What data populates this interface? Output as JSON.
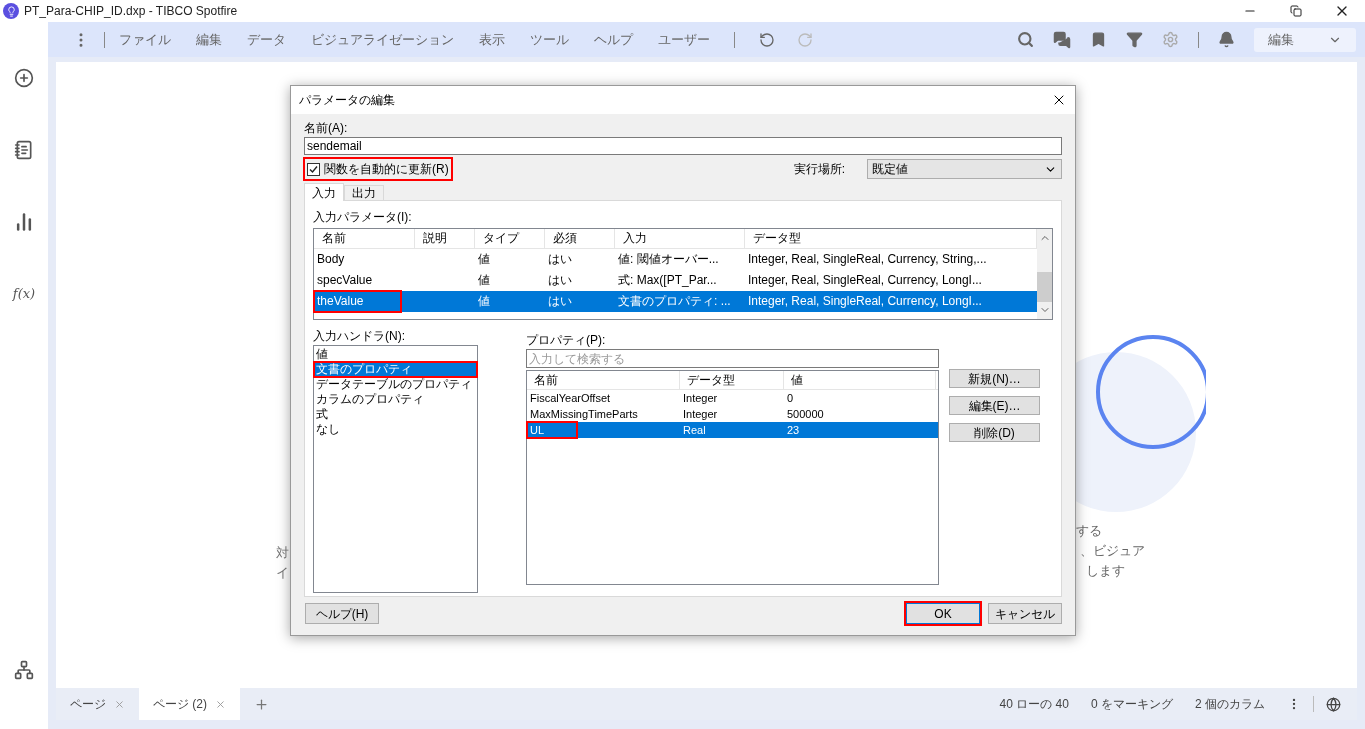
{
  "window": {
    "title": "PT_Para-CHIP_ID.dxp - TIBCO Spotfire"
  },
  "menu": [
    "ファイル",
    "編集",
    "データ",
    "ビジュアライゼーション",
    "表示",
    "ツール",
    "ヘルプ",
    "ユーザー"
  ],
  "mode_select": {
    "value": "編集"
  },
  "sidebar_formula": "f(x)",
  "canvas_fragments": {
    "left": [
      "対",
      "イ"
    ],
    "right": [
      "する",
      "、ビジュア",
      "します"
    ]
  },
  "dialog": {
    "title": "パラメータの編集",
    "name_label": "名前(A):",
    "name_value": "sendemail",
    "auto_update": {
      "label": "関数を自動的に更新(R)",
      "checked": true,
      "annotated": true
    },
    "location": {
      "label": "実行場所:",
      "value": "既定値"
    },
    "tabs": [
      {
        "label": "入力",
        "selected": true
      },
      {
        "label": "出力",
        "selected": false
      }
    ],
    "params_label": "入力パラメータ(I):",
    "params_table": {
      "columns": [
        "名前",
        "説明",
        "タイプ",
        "必須",
        "入力",
        "データ型"
      ],
      "rows": [
        {
          "cells": [
            "Body",
            "",
            "値",
            "はい",
            "値: 閾値オーバー...",
            "Integer, Real, SingleReal, Currency, String,..."
          ],
          "selected": false,
          "annotated": false
        },
        {
          "cells": [
            "specValue",
            "",
            "値",
            "はい",
            "式: Max([PT_Par...",
            "Integer, Real, SingleReal, Currency, LongI..."
          ],
          "selected": false,
          "annotated": false
        },
        {
          "cells": [
            "theValue",
            "",
            "値",
            "はい",
            "文書のプロパティ: ...",
            "Integer, Real, SingleReal, Currency, LongI..."
          ],
          "selected": true,
          "annotated": true
        }
      ]
    },
    "handlers_label": "入力ハンドラ(N):",
    "handlers": [
      {
        "label": "値",
        "selected": false,
        "annotated": false
      },
      {
        "label": "文書のプロパティ",
        "selected": true,
        "annotated": true
      },
      {
        "label": "データテーブルのプロパティ",
        "selected": false,
        "annotated": false
      },
      {
        "label": "カラムのプロパティ",
        "selected": false,
        "annotated": false
      },
      {
        "label": "式",
        "selected": false,
        "annotated": false
      },
      {
        "label": "なし",
        "selected": false,
        "annotated": false
      }
    ],
    "properties_label": "プロパティ(P):",
    "search": {
      "placeholder": "入力して検索する"
    },
    "properties_table": {
      "columns": [
        "名前",
        "データ型",
        "値"
      ],
      "rows": [
        {
          "cells": [
            "FiscalYearOffset",
            "Integer",
            "0"
          ],
          "selected": false,
          "annotated": false
        },
        {
          "cells": [
            "MaxMissingTimeParts",
            "Integer",
            "500000"
          ],
          "selected": false,
          "annotated": false
        },
        {
          "cells": [
            "UL",
            "Real",
            "23"
          ],
          "selected": true,
          "annotated": true
        }
      ]
    },
    "side_buttons": [
      "新規(N)…",
      "編集(E)…",
      "削除(D)"
    ],
    "help_button": "ヘルプ(H)",
    "ok_button": {
      "label": "OK",
      "annotated": true
    },
    "cancel_button": "キャンセル"
  },
  "page_tabs": [
    {
      "label": "ページ",
      "selected": false
    },
    {
      "label": "ページ (2)",
      "selected": true
    }
  ],
  "status": [
    "40 ローの 40",
    "0 をマーキング",
    "2 個のカラム"
  ]
}
